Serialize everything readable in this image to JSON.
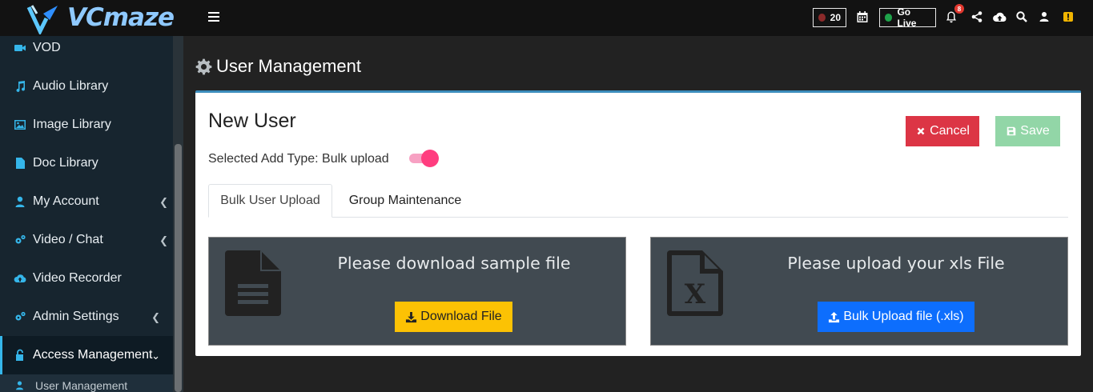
{
  "brand": {
    "logo_text": "VCmaze"
  },
  "sidebar": {
    "items": [
      {
        "label": "VOD",
        "icon": "video-camera-icon",
        "has_chevron": false
      },
      {
        "label": "Audio Library",
        "icon": "music-note-icon",
        "has_chevron": false
      },
      {
        "label": "Image Library",
        "icon": "image-icon",
        "has_chevron": false
      },
      {
        "label": "Doc Library",
        "icon": "document-icon",
        "has_chevron": false
      },
      {
        "label": "My Account",
        "icon": "user-icon",
        "has_chevron": true
      },
      {
        "label": "Video / Chat",
        "icon": "cogs-icon",
        "has_chevron": true
      },
      {
        "label": "Video Recorder",
        "icon": "cloud-upload-icon",
        "has_chevron": false
      },
      {
        "label": "Admin Settings",
        "icon": "cogs-icon",
        "has_chevron": true
      },
      {
        "label": "Access Management",
        "icon": "unlock-icon",
        "has_chevron": true,
        "active": true
      }
    ],
    "sub_items": [
      {
        "label": "User Management",
        "icon": "user-icon"
      }
    ]
  },
  "topbar": {
    "live_count": "20",
    "go_live_label": "Go Live",
    "notification_count": "8",
    "colors": {
      "red_dot": "#8b2a2a",
      "green_dot": "#1fa34a",
      "badge": "#e2382f",
      "warn": "#f0b400"
    }
  },
  "page": {
    "title": "User Management",
    "card_title": "New User",
    "add_type_label": "Selected Add Type: Bulk upload",
    "toggle_on": true,
    "buttons": {
      "cancel": "Cancel",
      "save": "Save"
    },
    "tabs": [
      {
        "label": "Bulk User Upload",
        "active": true
      },
      {
        "label": "Group Maintenance",
        "active": false
      }
    ],
    "panels": {
      "download": {
        "text": "Please download sample file",
        "button": "Download File"
      },
      "upload": {
        "text": "Please upload your xls File",
        "button": "Bulk Upload file (.xls)"
      }
    }
  }
}
